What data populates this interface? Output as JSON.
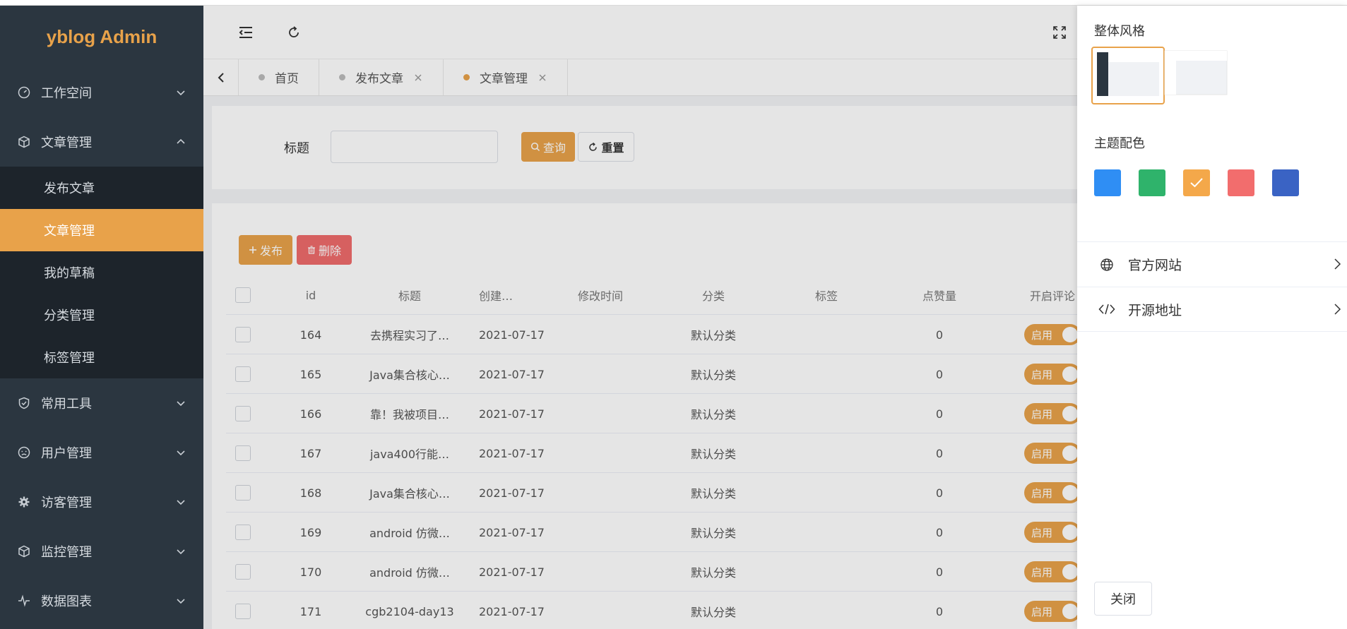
{
  "app": {
    "logo": "yblog Admin"
  },
  "sidebar": {
    "items": [
      {
        "label": "工作空间",
        "icon": "dashboard-icon",
        "expanded": false
      },
      {
        "label": "文章管理",
        "icon": "cube-icon",
        "expanded": true
      },
      {
        "label": "常用工具",
        "icon": "shield-check-icon",
        "expanded": false
      },
      {
        "label": "用户管理",
        "icon": "face-icon",
        "expanded": false
      },
      {
        "label": "访客管理",
        "icon": "gear-icon",
        "expanded": false
      },
      {
        "label": "监控管理",
        "icon": "cube-icon",
        "expanded": false
      },
      {
        "label": "数据图表",
        "icon": "pulse-icon",
        "expanded": false
      }
    ],
    "subitems": [
      {
        "label": "发布文章",
        "active": false
      },
      {
        "label": "文章管理",
        "active": true
      },
      {
        "label": "我的草稿",
        "active": false
      },
      {
        "label": "分类管理",
        "active": false
      },
      {
        "label": "标签管理",
        "active": false
      }
    ]
  },
  "header": {
    "menu_toggle_icon": "menu-fold-icon",
    "refresh_icon": "refresh-icon",
    "fullscreen_icon": "fullscreen-icon"
  },
  "tabs": [
    {
      "label": "首页",
      "closable": false,
      "active": false
    },
    {
      "label": "发布文章",
      "closable": true,
      "active": false
    },
    {
      "label": "文章管理",
      "closable": true,
      "active": true
    }
  ],
  "search": {
    "label": "标题",
    "placeholder": "",
    "query_label": "查询",
    "reset_label": "重置"
  },
  "actions": {
    "add_label": "发布",
    "delete_label": "删除"
  },
  "table": {
    "columns": [
      "id",
      "标题",
      "创建…",
      "修改时间",
      "分类",
      "标签",
      "点赞量",
      "开启评论"
    ],
    "rows": [
      {
        "id": "164",
        "title": "去携程实习了…",
        "created": "2021-07-17",
        "modified": "",
        "category": "默认分类",
        "tags": "",
        "likes": "0",
        "comment": "启用"
      },
      {
        "id": "165",
        "title": "Java集合核心…",
        "created": "2021-07-17",
        "modified": "",
        "category": "默认分类",
        "tags": "",
        "likes": "0",
        "comment": "启用"
      },
      {
        "id": "166",
        "title": "靠！我被项目…",
        "created": "2021-07-17",
        "modified": "",
        "category": "默认分类",
        "tags": "",
        "likes": "0",
        "comment": "启用"
      },
      {
        "id": "167",
        "title": "java400行能…",
        "created": "2021-07-17",
        "modified": "",
        "category": "默认分类",
        "tags": "",
        "likes": "0",
        "comment": "启用"
      },
      {
        "id": "168",
        "title": "Java集合核心…",
        "created": "2021-07-17",
        "modified": "",
        "category": "默认分类",
        "tags": "",
        "likes": "0",
        "comment": "启用"
      },
      {
        "id": "169",
        "title": "android 仿微…",
        "created": "2021-07-17",
        "modified": "",
        "category": "默认分类",
        "tags": "",
        "likes": "0",
        "comment": "启用"
      },
      {
        "id": "170",
        "title": "android 仿微…",
        "created": "2021-07-17",
        "modified": "",
        "category": "默认分类",
        "tags": "",
        "likes": "0",
        "comment": "启用"
      },
      {
        "id": "171",
        "title": "cgb2104-day13",
        "created": "2021-07-17",
        "modified": "",
        "category": "默认分类",
        "tags": "",
        "likes": "0",
        "comment": "启用"
      }
    ]
  },
  "drawer": {
    "style_title": "整体风格",
    "theme_title": "主题配色",
    "theme_colors": [
      "#2f8ef4",
      "#2fb36b",
      "#f4a84a",
      "#f26d6d",
      "#3a63c4"
    ],
    "selected_theme": 2,
    "links": [
      {
        "label": "官方网站",
        "icon": "globe-icon"
      },
      {
        "label": "开源地址",
        "icon": "code-icon"
      }
    ],
    "close_label": "关闭"
  },
  "colors": {
    "accent": "#e8a24a",
    "sidebar_bg": "#2b3640",
    "submenu_bg": "#1d242b",
    "danger": "#ef6b6b"
  }
}
